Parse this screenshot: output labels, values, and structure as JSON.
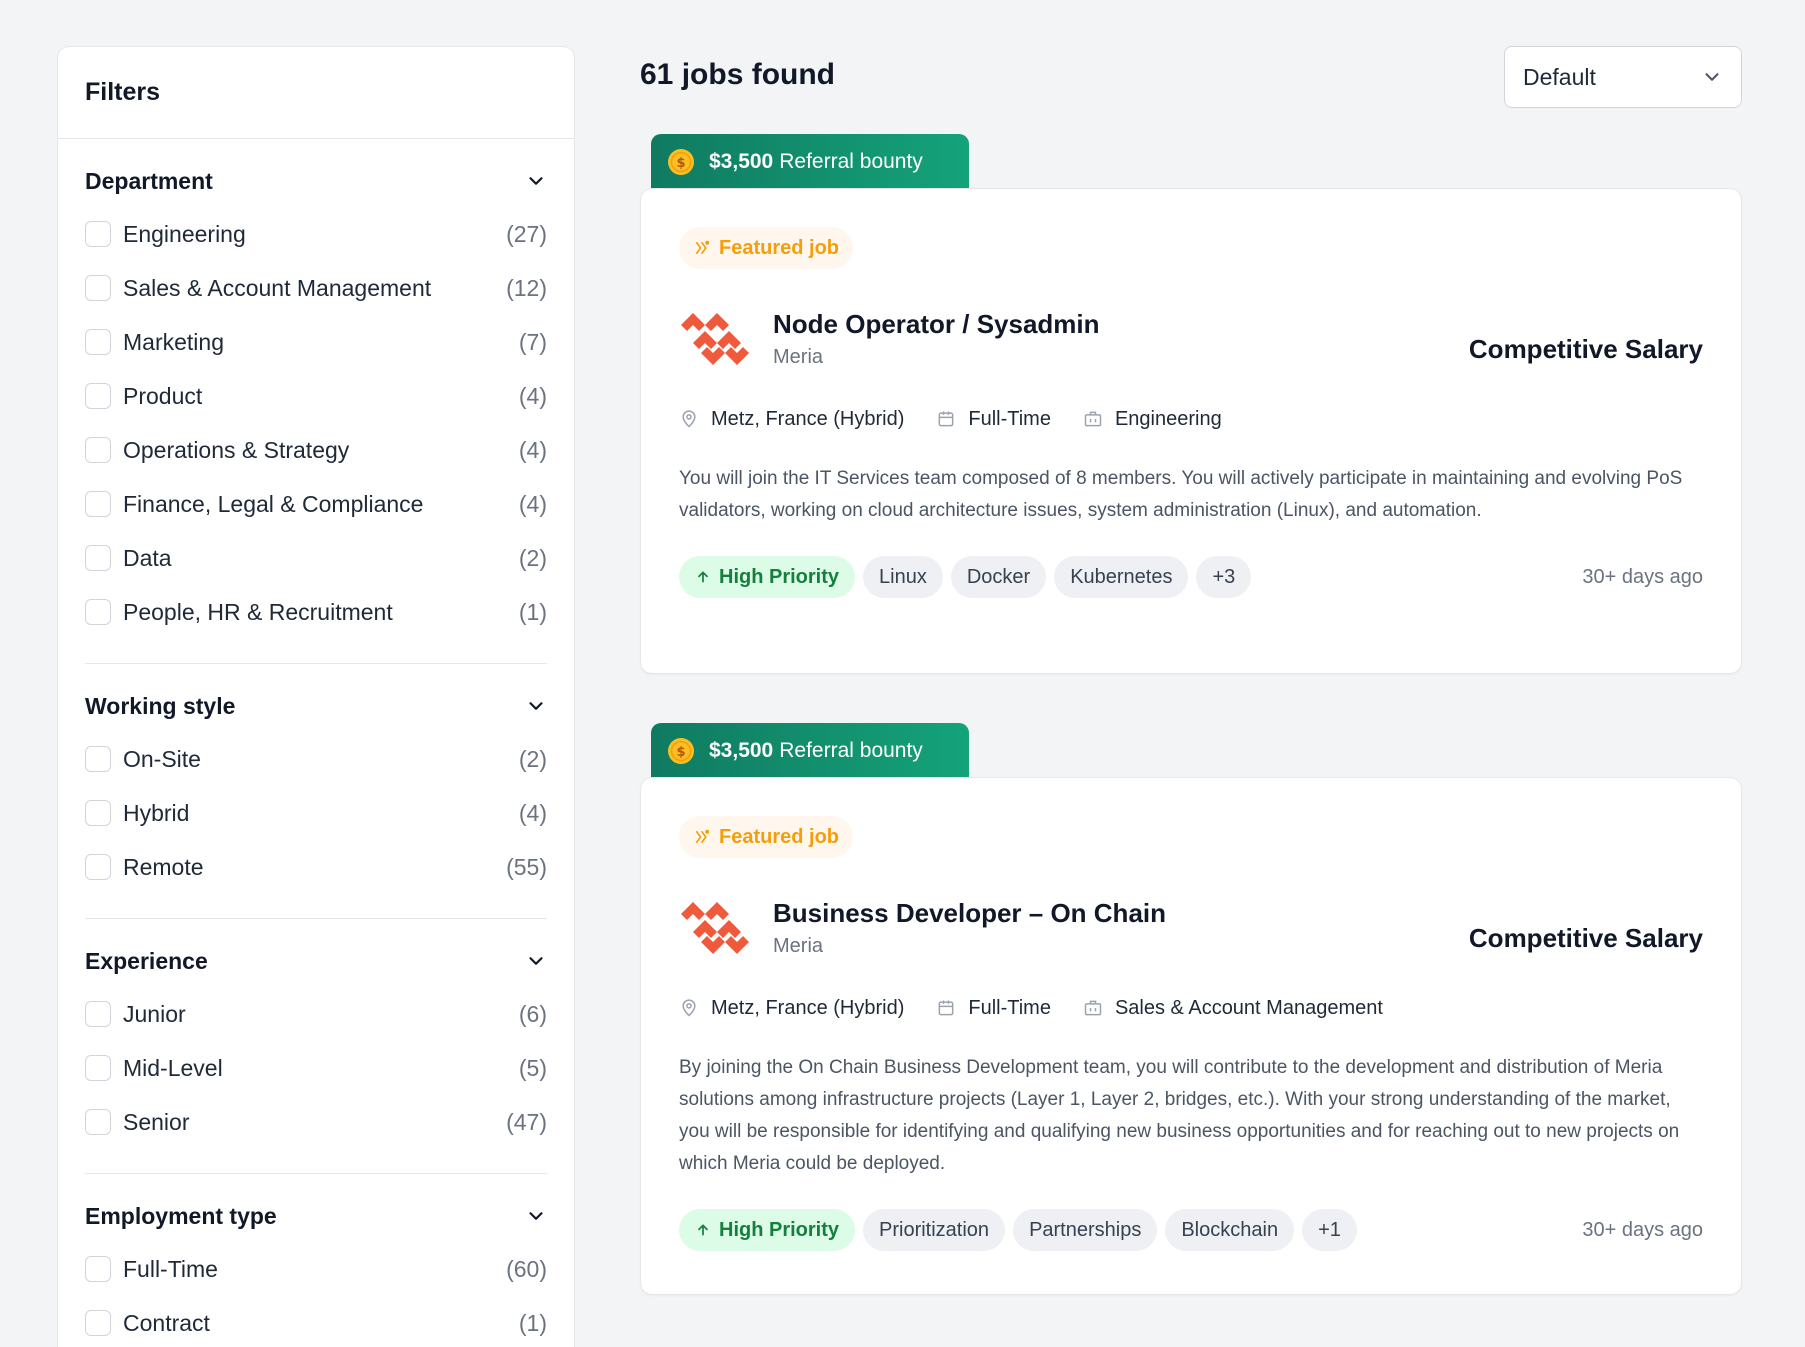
{
  "filters": {
    "title": "Filters",
    "sections": [
      {
        "title": "Department",
        "options": [
          {
            "label": "Engineering",
            "count": "(27)"
          },
          {
            "label": "Sales & Account Management",
            "count": "(12)"
          },
          {
            "label": "Marketing",
            "count": "(7)"
          },
          {
            "label": "Product",
            "count": "(4)"
          },
          {
            "label": "Operations & Strategy",
            "count": "(4)"
          },
          {
            "label": "Finance, Legal & Compliance",
            "count": "(4)"
          },
          {
            "label": "Data",
            "count": "(2)"
          },
          {
            "label": "People, HR & Recruitment",
            "count": "(1)"
          }
        ]
      },
      {
        "title": "Working style",
        "options": [
          {
            "label": "On-Site",
            "count": "(2)"
          },
          {
            "label": "Hybrid",
            "count": "(4)"
          },
          {
            "label": "Remote",
            "count": "(55)"
          }
        ]
      },
      {
        "title": "Experience",
        "options": [
          {
            "label": "Junior",
            "count": "(6)"
          },
          {
            "label": "Mid-Level",
            "count": "(5)"
          },
          {
            "label": "Senior",
            "count": "(47)"
          }
        ]
      },
      {
        "title": "Employment type",
        "options": [
          {
            "label": "Full-Time",
            "count": "(60)"
          },
          {
            "label": "Contract",
            "count": "(1)"
          }
        ]
      }
    ]
  },
  "results": {
    "title": "61 jobs found",
    "sort_value": "Default"
  },
  "jobs": [
    {
      "bounty_amount": "$3,500",
      "bounty_label": "Referral bounty",
      "featured_label": "Featured job",
      "title": "Node Operator / Sysadmin",
      "company": "Meria",
      "salary": "Competitive Salary",
      "location": "Metz, France (Hybrid)",
      "employment": "Full-Time",
      "department": "Engineering",
      "description": "You will join the IT Services team composed of 8 members. You will actively participate in maintaining and evolving PoS validators, working on cloud architecture issues, system administration (Linux), and automation.",
      "priority": "High Priority",
      "tags": [
        "Linux",
        "Docker",
        "Kubernetes",
        "+3"
      ],
      "posted": "30+ days ago"
    },
    {
      "bounty_amount": "$3,500",
      "bounty_label": "Referral bounty",
      "featured_label": "Featured job",
      "title": "Business Developer – On Chain",
      "company": "Meria",
      "salary": "Competitive Salary",
      "location": "Metz, France (Hybrid)",
      "employment": "Full-Time",
      "department": "Sales & Account Management",
      "description": "By joining the On Chain Business Development team, you will contribute to the development and distribution of Meria solutions among infrastructure projects (Layer 1, Layer 2, bridges, etc.). With your strong understanding of the market, you will be responsible for identifying and qualifying new business opportunities and for reaching out to new projects on which Meria could be deployed.",
      "priority": "High Priority",
      "tags": [
        "Prioritization",
        "Partnerships",
        "Blockchain",
        "+1"
      ],
      "posted": "30+ days ago"
    }
  ],
  "colors": {
    "bounty_start": "#107a60",
    "bounty_end": "#14a37a",
    "featured": "#f59e0b",
    "priority": "#15803d",
    "logo": "#f05a3c"
  }
}
